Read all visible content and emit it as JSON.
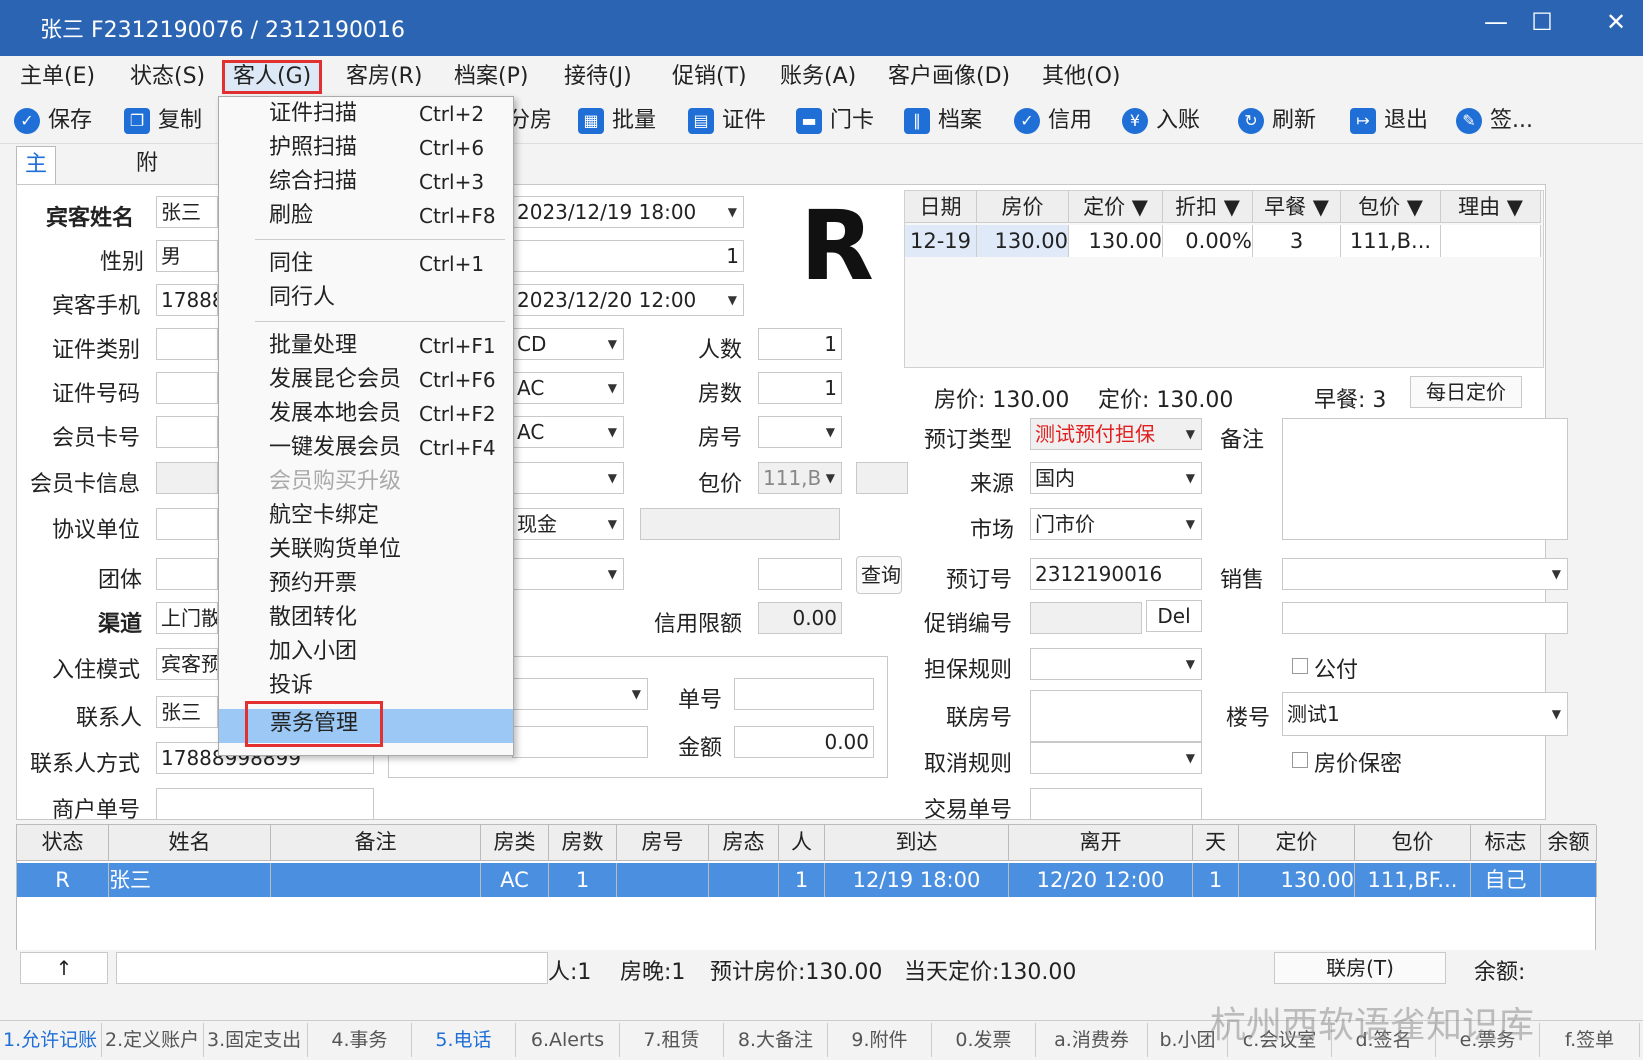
{
  "window": {
    "title": "张三 F2312190076 / 2312190016",
    "min": "—",
    "max": "☐",
    "close": "✕"
  },
  "menu": [
    "主单(E)",
    "状态(S)",
    "客人(G)",
    "客房(R)",
    "档案(P)",
    "接待(J)",
    "促销(T)",
    "账务(A)",
    "客户画像(D)",
    "其他(O)"
  ],
  "toolbar": {
    "save": "保存",
    "copy": "复制",
    "room": "分房",
    "batch": "批量",
    "cert": "证件",
    "card": "门卡",
    "archive": "档案",
    "credit": "信用",
    "posting": "入账",
    "refresh": "刷新",
    "exit": "退出",
    "sign": "签..."
  },
  "tabs": {
    "main": "主要信息",
    "extra": "附加信息"
  },
  "form": {
    "guest_name_l": "宾客姓名",
    "guest_name": "张三",
    "gender_l": "性别",
    "gender": "男",
    "phone_l": "宾客手机",
    "phone": "17888",
    "idtype_l": "证件类别",
    "idno_l": "证件号码",
    "member_l": "会员卡号",
    "memberinfo_l": "会员卡信息",
    "agreement_l": "协议单位",
    "group_l": "团体",
    "channel_l": "渠道",
    "channel": "上门散",
    "checkin_l": "入住模式",
    "checkin": "宾客预",
    "contact_l": "联系人",
    "contact": "张三",
    "contactway_l": "联系人方式",
    "contactway": "17888998899",
    "merchant_l": "商户单号",
    "arrive": "2023/12/19 18:00",
    "nights": "1",
    "depart": "2023/12/20 12:00",
    "roomtype_cd": "CD",
    "roomtype_ac1": "AC",
    "roomtype_ac2": "AC",
    "pay": "现金",
    "persons_l": "人数",
    "persons": "1",
    "rooms_l": "房数",
    "rooms": "1",
    "roomno_l": "房号",
    "package_l": "包价",
    "package": "111,B",
    "query": "查询",
    "creditlimit_l": "信用限额",
    "creditlimit": "0.00",
    "billno_l": "单号",
    "amount_l": "金额",
    "amount": "0.00",
    "bookingtype_l": "预订类型",
    "bookingtype": "测试预付担保",
    "source_l": "来源",
    "source": "国内",
    "market_l": "市场",
    "market": "门市价",
    "bookingno_l": "预订号",
    "bookingno": "2312190016",
    "promo_l": "促销编号",
    "del": "Del",
    "guarantee_l": "担保规则",
    "linkroom_l": "联房号",
    "cancel_l": "取消规则",
    "trade_l": "交易单号",
    "remark_l": "备注",
    "sales_l": "销售",
    "public_l": "公付",
    "building_l": "楼号",
    "building": "测试1",
    "secret_l": "房价保密"
  },
  "big_letter": "R",
  "rate_grid": {
    "headers": [
      "日期",
      "房价",
      "定价 ▼",
      "折扣 ▼",
      "早餐 ▼",
      "包价 ▼",
      "理由 ▼"
    ],
    "row": [
      "12-19",
      "130.00",
      "130.00",
      "0.00%",
      "3",
      "111,B...",
      ""
    ],
    "summary_price": "房价: 130.00",
    "summary_fixed": "定价: 130.00",
    "summary_bf": "早餐: 3",
    "daily": "每日定价"
  },
  "guest_grid": {
    "headers": [
      "状态",
      "姓名",
      "备注",
      "房类",
      "房数",
      "房号",
      "房态",
      "人",
      "到达",
      "离开",
      "天",
      "定价",
      "包价",
      "标志",
      "余额"
    ],
    "row": [
      "R",
      "张三",
      "",
      "AC",
      "1",
      "",
      "",
      "1",
      "12/19 18:00",
      "12/20 12:00",
      "1",
      "130.00",
      "111,BF...",
      "自己",
      ""
    ]
  },
  "status_bar": {
    "arrow": "↑",
    "persons": "人:1",
    "nights": "房晚:1",
    "estimate": "预计房价:130.00",
    "today": "当天定价:130.00",
    "link": "联房(T)",
    "balance": "余额:"
  },
  "bottom_tabs": [
    "1.允许记账",
    "2.定义账户",
    "3.固定支出",
    "4.事务",
    "5.电话",
    "6.Alerts",
    "7.租赁",
    "8.大备注",
    "9.附件",
    "0.发票",
    "a.消费券",
    "b.小团",
    "c.会议室",
    "d.签名",
    "e.票务",
    "f.签单"
  ],
  "dropdown": [
    {
      "label": "证件扫描",
      "shortcut": "Ctrl+2"
    },
    {
      "label": "护照扫描",
      "shortcut": "Ctrl+6"
    },
    {
      "label": "综合扫描",
      "shortcut": "Ctrl+3"
    },
    {
      "label": "刷脸",
      "shortcut": "Ctrl+F8"
    },
    {
      "label": "同住",
      "shortcut": "Ctrl+1"
    },
    {
      "label": "同行人",
      "shortcut": ""
    },
    {
      "label": "批量处理",
      "shortcut": "Ctrl+F1"
    },
    {
      "label": "发展昆仑会员",
      "shortcut": "Ctrl+F6"
    },
    {
      "label": "发展本地会员",
      "shortcut": "Ctrl+F2"
    },
    {
      "label": "一键发展会员",
      "shortcut": "Ctrl+F4"
    },
    {
      "label": "会员购买升级",
      "shortcut": ""
    },
    {
      "label": "航空卡绑定",
      "shortcut": ""
    },
    {
      "label": "关联购货单位",
      "shortcut": ""
    },
    {
      "label": "预约开票",
      "shortcut": ""
    },
    {
      "label": "散团转化",
      "shortcut": ""
    },
    {
      "label": "加入小团",
      "shortcut": ""
    },
    {
      "label": "投诉",
      "shortcut": ""
    },
    {
      "label": "票务管理",
      "shortcut": ""
    }
  ],
  "watermark": "杭州西软语雀知识库",
  "colors": {
    "title_bg": "#2a64b2",
    "accent": "#1f6fd6",
    "highlight_box": "#e23030",
    "selected_row": "#4a8fe0",
    "red_text": "#e02020"
  }
}
